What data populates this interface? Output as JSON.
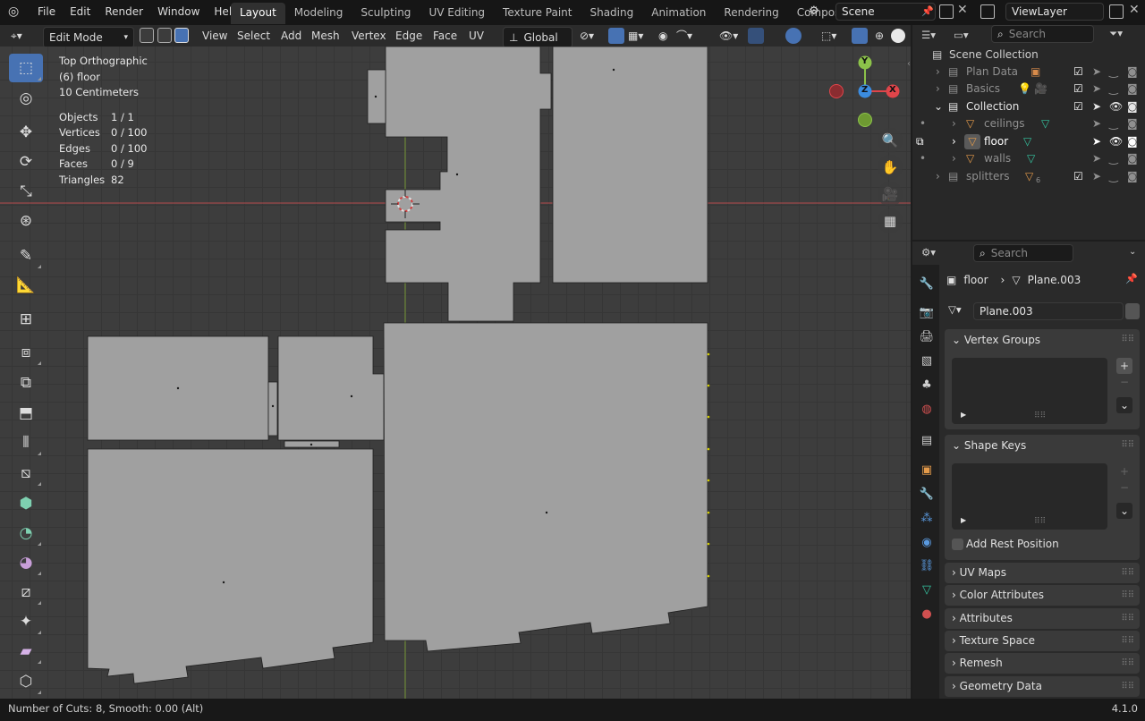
{
  "app": {
    "name": "Blender",
    "version": "4.1.0"
  },
  "menu": [
    "File",
    "Edit",
    "Render",
    "Window",
    "Help"
  ],
  "workspaces": [
    "Layout",
    "Modeling",
    "Sculpting",
    "UV Editing",
    "Texture Paint",
    "Shading",
    "Animation",
    "Rendering",
    "Compositing"
  ],
  "active_workspace": "Layout",
  "scene": {
    "label": "Scene",
    "viewlayer": "ViewLayer"
  },
  "viewport_header": {
    "mode": "Edit Mode",
    "menus": [
      "View",
      "Select",
      "Add",
      "Mesh",
      "Vertex",
      "Edge",
      "Face",
      "UV"
    ],
    "orientation": "Global"
  },
  "viewport_info": {
    "view": "Top Orthographic",
    "object": "(6) floor",
    "scale": "10 Centimeters",
    "stats": [
      {
        "label": "Objects",
        "value": "1 / 1"
      },
      {
        "label": "Vertices",
        "value": "0 / 100"
      },
      {
        "label": "Edges",
        "value": "0 / 100"
      },
      {
        "label": "Faces",
        "value": "0 / 9"
      },
      {
        "label": "Triangles",
        "value": "82"
      }
    ]
  },
  "gizmo": {
    "x": "X",
    "y": "Y",
    "z": "Z"
  },
  "outliner": {
    "search_placeholder": "Search",
    "root": "Scene Collection",
    "items": [
      {
        "name": "Plan Data"
      },
      {
        "name": "Basics"
      },
      {
        "name": "Collection"
      },
      {
        "name": "ceilings"
      },
      {
        "name": "floor"
      },
      {
        "name": "walls"
      },
      {
        "name": "splitters",
        "badge": "6"
      }
    ]
  },
  "properties": {
    "search_placeholder": "Search",
    "breadcrumb": {
      "object": "floor",
      "data": "Plane.003"
    },
    "datablock": "Plane.003",
    "panels": {
      "vertex_groups": "Vertex Groups",
      "shape_keys": "Shape Keys",
      "add_rest_position": "Add Rest Position",
      "uv_maps": "UV Maps",
      "color_attributes": "Color Attributes",
      "attributes": "Attributes",
      "texture_space": "Texture Space",
      "remesh": "Remesh",
      "geometry_data": "Geometry Data"
    }
  },
  "status": {
    "operator": "Number of Cuts: 8, Smooth: 0.00 (Alt)",
    "version": "4.1.0"
  },
  "colors": {
    "accent": "#4772b3",
    "floor": "#a0a0a0",
    "background": "#3d3d3d",
    "x_axis": "#e0454a",
    "y_axis": "#8cc24a",
    "z_axis": "#3b8ce0"
  }
}
